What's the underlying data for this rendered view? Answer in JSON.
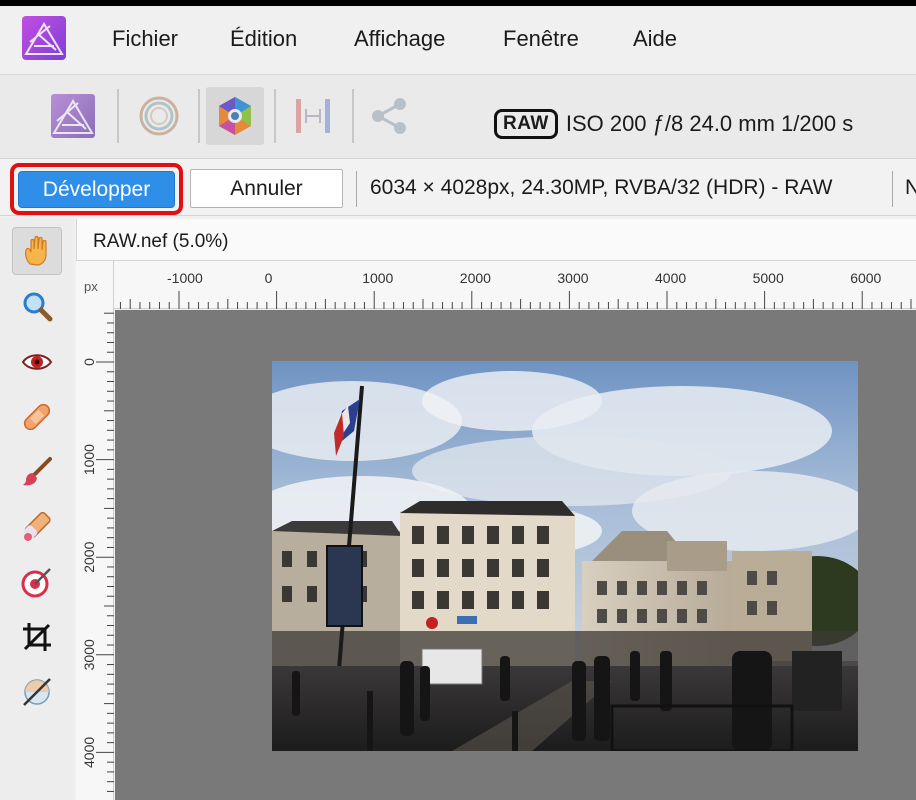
{
  "menu": {
    "items": [
      "Fichier",
      "Édition",
      "Affichage",
      "Fenêtre",
      "Aide"
    ]
  },
  "toolbar": {
    "personas": [
      "photo-persona",
      "liquify-persona",
      "develop-persona",
      "tone-mapping-persona",
      "export-persona"
    ],
    "raw_badge": "RAW",
    "raw_info": "ISO 200 ƒ/8 24.0 mm 1/200 s"
  },
  "context": {
    "develop_label": "Développer",
    "cancel_label": "Annuler",
    "doc_info": "6034 × 4028px, 24.30MP, RVBA/32 (HDR) - RAW",
    "doc_more": "N"
  },
  "document": {
    "tab_title": "RAW.nef (5.0%)"
  },
  "ruler": {
    "unit": "px",
    "h_labels": [
      "-1000",
      "0",
      "1000",
      "2000",
      "3000",
      "4000",
      "5000",
      "6000"
    ],
    "v_labels": [
      "0",
      "1000",
      "2000",
      "3000",
      "4000"
    ]
  },
  "tools": [
    "view-tool",
    "zoom-tool",
    "red-eye-tool",
    "blemish-tool",
    "brush-tool",
    "erase-tool",
    "gradient-tool",
    "crop-tool",
    "white-balance-tool"
  ],
  "colors": {
    "accent": "#2f8ee8",
    "highlight": "#e01010",
    "canvas": "#797979"
  }
}
